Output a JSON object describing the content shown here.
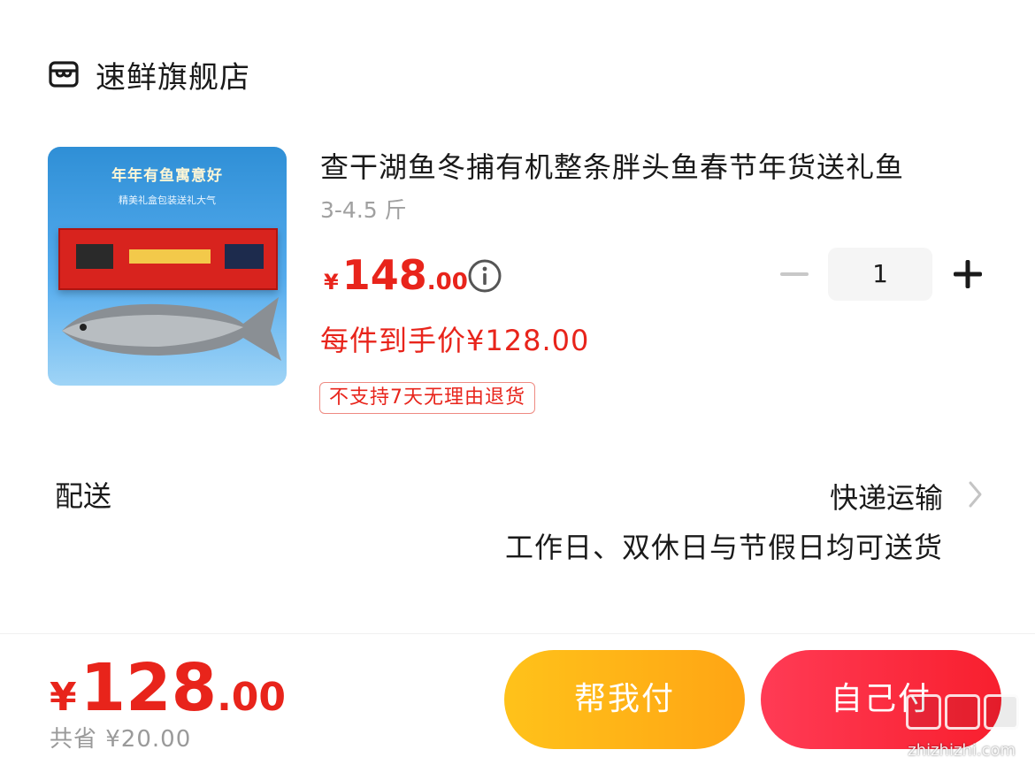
{
  "store": {
    "name": "速鲜旗舰店",
    "icon": "store-icon"
  },
  "product": {
    "image_title": "年年有鱼寓意好",
    "image_subtitle": "精美礼盒包装送礼大气",
    "title": "查干湖鱼冬捕有机整条胖头鱼春节年货送礼鱼",
    "spec": "3-4.5 斤",
    "price_currency": "¥",
    "price_int": "148",
    "price_dec": ".00",
    "quantity": "1",
    "final_price": "每件到手价¥128.00",
    "tag": "不支持7天无理由退货"
  },
  "delivery": {
    "label": "配送",
    "method": "快递运输",
    "note": "工作日、双休日与节假日均可送货"
  },
  "footer": {
    "currency": "¥",
    "total_int": "128",
    "total_dec": ".00",
    "saved": "共省 ¥20.00",
    "help_pay": "帮我付",
    "self_pay": "自己付",
    "watermark": "zhizhizhi.com"
  },
  "colors": {
    "accent": "#e8241b",
    "help_btn": "#ffb316",
    "self_btn": "#f8263a"
  }
}
